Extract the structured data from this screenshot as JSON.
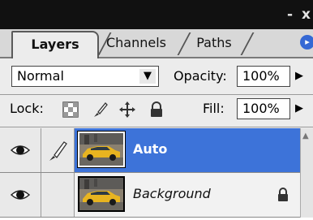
{
  "tabs": [
    {
      "label": "Layers",
      "active": true
    },
    {
      "label": "Channels",
      "active": false
    },
    {
      "label": "Paths",
      "active": false
    }
  ],
  "title_buttons": {
    "minimize": "-",
    "close": "x"
  },
  "blend_mode": {
    "value": "Normal"
  },
  "opacity": {
    "label": "Opacity:",
    "value": "100%"
  },
  "lock": {
    "label": "Lock:",
    "icons": [
      "lock-transparent-icon",
      "lock-paint-icon",
      "lock-move-icon",
      "lock-all-icon"
    ]
  },
  "fill": {
    "label": "Fill:",
    "value": "100%"
  },
  "layers": [
    {
      "name": "Auto",
      "visible": true,
      "selected": true,
      "locked": false
    },
    {
      "name": "Background",
      "visible": true,
      "selected": false,
      "locked": true
    }
  ],
  "colors": {
    "selection": "#3d73d9",
    "titlebar": "#111111",
    "panel": "#ececec"
  }
}
